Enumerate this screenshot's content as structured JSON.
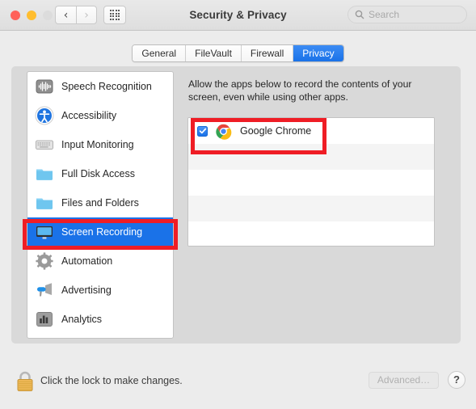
{
  "window": {
    "title": "Security & Privacy",
    "traffic_lights": [
      "close",
      "minimize",
      "zoom-disabled"
    ],
    "back_label": "‹",
    "forward_label": "›",
    "grid_icon": "grid-view-icon"
  },
  "search": {
    "placeholder": "Search",
    "value": "",
    "icon": "search-icon"
  },
  "tabs": [
    {
      "label": "General",
      "active": false
    },
    {
      "label": "FileVault",
      "active": false
    },
    {
      "label": "Firewall",
      "active": false
    },
    {
      "label": "Privacy",
      "active": true
    }
  ],
  "sidebar": {
    "items": [
      {
        "label": "Speech Recognition",
        "icon": "waveform-icon",
        "selected": false
      },
      {
        "label": "Accessibility",
        "icon": "accessibility-icon",
        "selected": false
      },
      {
        "label": "Input Monitoring",
        "icon": "keyboard-icon",
        "selected": false
      },
      {
        "label": "Full Disk Access",
        "icon": "folder-icon",
        "selected": false
      },
      {
        "label": "Files and Folders",
        "icon": "folder-icon",
        "selected": false
      },
      {
        "label": "Screen Recording",
        "icon": "display-icon",
        "selected": true
      },
      {
        "label": "Automation",
        "icon": "gear-icon",
        "selected": false
      },
      {
        "label": "Advertising",
        "icon": "megaphone-icon",
        "selected": false
      },
      {
        "label": "Analytics",
        "icon": "bar-chart-icon",
        "selected": false
      }
    ]
  },
  "main": {
    "description": "Allow the apps below to record the contents of your screen, even while using other apps.",
    "apps": [
      {
        "name": "Google Chrome",
        "icon": "chrome-icon",
        "checked": true
      }
    ],
    "empty_rows": 4
  },
  "bottom": {
    "lock_icon": "lock-closed-icon",
    "lock_text": "Click the lock to make changes.",
    "advanced_label": "Advanced…",
    "advanced_enabled": false,
    "help_label": "?"
  },
  "annotations": {
    "accent_color": "#ef1d25",
    "boxes": [
      {
        "target": "Screen Recording"
      },
      {
        "target": "Google Chrome"
      }
    ]
  },
  "colors": {
    "selection_blue": "#1a72e8",
    "window_chrome": "#ececec",
    "panel_gray": "#d9d9d9",
    "annotation_red": "#ef1d25"
  }
}
